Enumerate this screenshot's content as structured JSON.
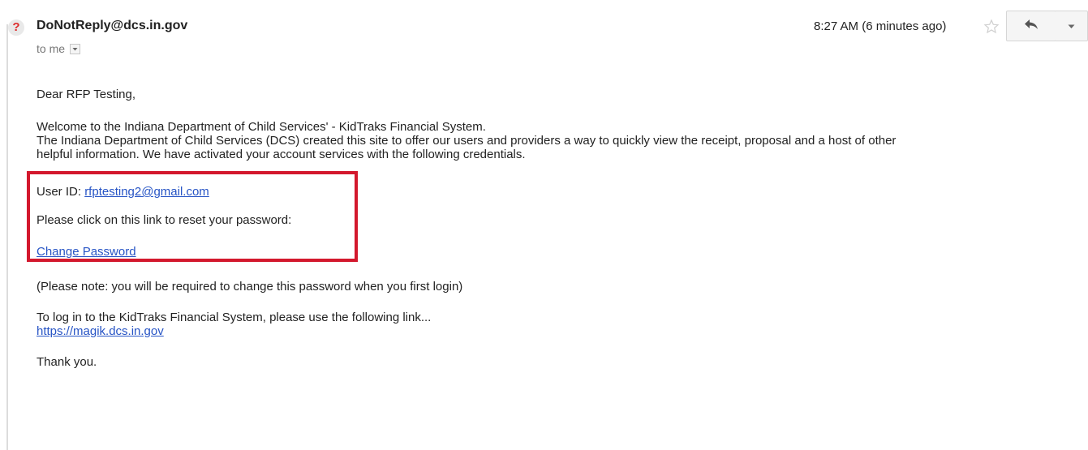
{
  "header": {
    "avatar_glyph": "?",
    "sender": "DoNotReply@dcs.in.gov",
    "recipient_label": "to me",
    "timestamp": "8:27 AM (6 minutes ago)"
  },
  "body": {
    "greeting": "Dear RFP Testing,",
    "intro_line1": "Welcome to the Indiana Department of Child Services' - KidTraks Financial System.",
    "intro_line2": "The Indiana Department of Child Services (DCS) created this site to offer our users and providers a way to quickly view the receipt, proposal and a host of other",
    "intro_line3": "helpful information. We have activated your account services with the following credentials.",
    "userid_label": "User ID: ",
    "userid_value": "rfptesting2@gmail.com",
    "reset_text": "Please click on this link to reset your password:",
    "change_password_label": "Change Password",
    "note": "(Please note: you will be required to change this password when you first login)",
    "login_text": "To log in to the KidTraks Financial System, please use the following link...",
    "login_url": "https://magik.dcs.in.gov",
    "thanks": "Thank you."
  },
  "colors": {
    "highlight_box": "#d3182d",
    "link": "#2754c5",
    "avatar_glyph": "#dd2c2c"
  },
  "icons": {
    "avatar": "question-mark-icon",
    "recipient_dropdown": "caret-down-icon",
    "star": "star-icon",
    "reply": "reply-arrow-icon",
    "more": "chevron-down-icon"
  }
}
